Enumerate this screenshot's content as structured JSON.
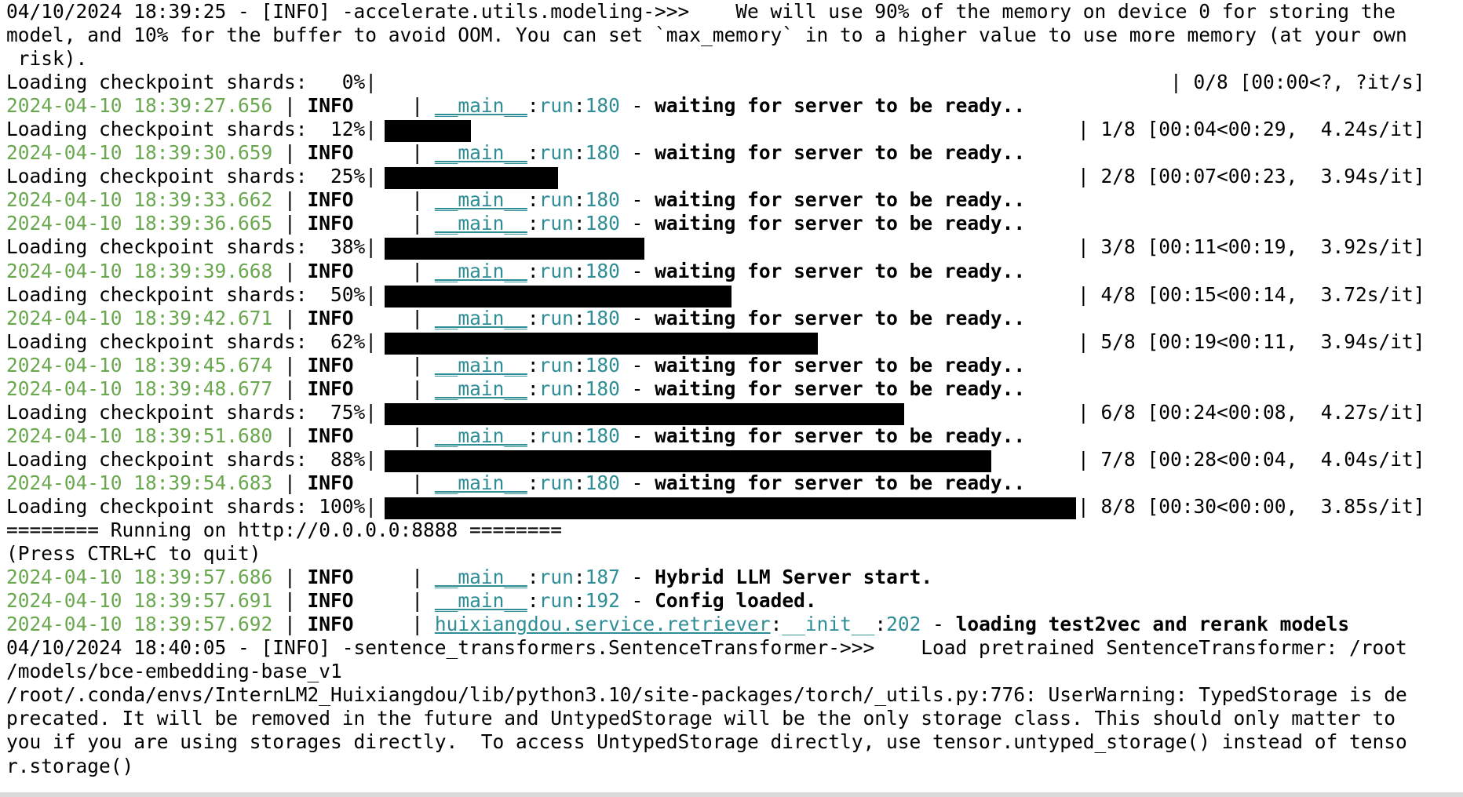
{
  "colors": {
    "background": "#ffffff",
    "text": "#000000",
    "timestamp": "#6aa84f",
    "module": "#2f8d96",
    "progress_fill": "#000000"
  },
  "lines": [
    {
      "kind": "plain",
      "text": "04/10/2024 18:39:25 - [INFO] -accelerate.utils.modeling->>>    We will use 90% of the memory on device 0 for storing the"
    },
    {
      "kind": "plain",
      "text": "model, and 10% for the buffer to avoid OOM. You can set `max_memory` in to a higher value to use more memory (at your own"
    },
    {
      "kind": "plain",
      "text": " risk)."
    },
    {
      "kind": "progress",
      "prefix": "Loading checkpoint shards:   0%|",
      "fraction": 0.0,
      "stats": "| 0/8 [00:00<?, ?it/s]",
      "stats_offset_chars": 8
    },
    {
      "kind": "log",
      "ts": "2024-04-10 18:39:27.656",
      "sep1": " | ",
      "lvl": "INFO",
      "sep2": "     | ",
      "mod": "__main__",
      "colon1": ":",
      "fn": "run",
      "colon2": ":",
      "lnum": "180",
      "dash": " - ",
      "msg": "waiting for server to be ready.."
    },
    {
      "kind": "progress",
      "prefix": "Loading checkpoint shards:  12%|",
      "fraction": 0.125,
      "stats": "| 1/8 [00:04<00:29,  4.24s/it]"
    },
    {
      "kind": "log",
      "ts": "2024-04-10 18:39:30.659",
      "sep1": " | ",
      "lvl": "INFO",
      "sep2": "     | ",
      "mod": "__main__",
      "colon1": ":",
      "fn": "run",
      "colon2": ":",
      "lnum": "180",
      "dash": " - ",
      "msg": "waiting for server to be ready.."
    },
    {
      "kind": "progress",
      "prefix": "Loading checkpoint shards:  25%|",
      "fraction": 0.25,
      "stats": "| 2/8 [00:07<00:23,  3.94s/it]"
    },
    {
      "kind": "log",
      "ts": "2024-04-10 18:39:33.662",
      "sep1": " | ",
      "lvl": "INFO",
      "sep2": "     | ",
      "mod": "__main__",
      "colon1": ":",
      "fn": "run",
      "colon2": ":",
      "lnum": "180",
      "dash": " - ",
      "msg": "waiting for server to be ready.."
    },
    {
      "kind": "log",
      "ts": "2024-04-10 18:39:36.665",
      "sep1": " | ",
      "lvl": "INFO",
      "sep2": "     | ",
      "mod": "__main__",
      "colon1": ":",
      "fn": "run",
      "colon2": ":",
      "lnum": "180",
      "dash": " - ",
      "msg": "waiting for server to be ready.."
    },
    {
      "kind": "progress",
      "prefix": "Loading checkpoint shards:  38%|",
      "fraction": 0.375,
      "stats": "| 3/8 [00:11<00:19,  3.92s/it]"
    },
    {
      "kind": "log",
      "ts": "2024-04-10 18:39:39.668",
      "sep1": " | ",
      "lvl": "INFO",
      "sep2": "     | ",
      "mod": "__main__",
      "colon1": ":",
      "fn": "run",
      "colon2": ":",
      "lnum": "180",
      "dash": " - ",
      "msg": "waiting for server to be ready.."
    },
    {
      "kind": "progress",
      "prefix": "Loading checkpoint shards:  50%|",
      "fraction": 0.5,
      "stats": "| 4/8 [00:15<00:14,  3.72s/it]"
    },
    {
      "kind": "log",
      "ts": "2024-04-10 18:39:42.671",
      "sep1": " | ",
      "lvl": "INFO",
      "sep2": "     | ",
      "mod": "__main__",
      "colon1": ":",
      "fn": "run",
      "colon2": ":",
      "lnum": "180",
      "dash": " - ",
      "msg": "waiting for server to be ready.."
    },
    {
      "kind": "progress",
      "prefix": "Loading checkpoint shards:  62%|",
      "fraction": 0.625,
      "stats": "| 5/8 [00:19<00:11,  3.94s/it]"
    },
    {
      "kind": "log",
      "ts": "2024-04-10 18:39:45.674",
      "sep1": " | ",
      "lvl": "INFO",
      "sep2": "     | ",
      "mod": "__main__",
      "colon1": ":",
      "fn": "run",
      "colon2": ":",
      "lnum": "180",
      "dash": " - ",
      "msg": "waiting for server to be ready.."
    },
    {
      "kind": "log",
      "ts": "2024-04-10 18:39:48.677",
      "sep1": " | ",
      "lvl": "INFO",
      "sep2": "     | ",
      "mod": "__main__",
      "colon1": ":",
      "fn": "run",
      "colon2": ":",
      "lnum": "180",
      "dash": " - ",
      "msg": "waiting for server to be ready.."
    },
    {
      "kind": "progress",
      "prefix": "Loading checkpoint shards:  75%|",
      "fraction": 0.75,
      "stats": "| 6/8 [00:24<00:08,  4.27s/it]"
    },
    {
      "kind": "log",
      "ts": "2024-04-10 18:39:51.680",
      "sep1": " | ",
      "lvl": "INFO",
      "sep2": "     | ",
      "mod": "__main__",
      "colon1": ":",
      "fn": "run",
      "colon2": ":",
      "lnum": "180",
      "dash": " - ",
      "msg": "waiting for server to be ready.."
    },
    {
      "kind": "progress",
      "prefix": "Loading checkpoint shards:  88%|",
      "fraction": 0.875,
      "stats": "| 7/8 [00:28<00:04,  4.04s/it]"
    },
    {
      "kind": "log",
      "ts": "2024-04-10 18:39:54.683",
      "sep1": " | ",
      "lvl": "INFO",
      "sep2": "     | ",
      "mod": "__main__",
      "colon1": ":",
      "fn": "run",
      "colon2": ":",
      "lnum": "180",
      "dash": " - ",
      "msg": "waiting for server to be ready.."
    },
    {
      "kind": "progress",
      "prefix": "Loading checkpoint shards: 100%|",
      "fraction": 1.0,
      "stats": "| 8/8 [00:30<00:00,  3.85s/it]"
    },
    {
      "kind": "plain",
      "text": "======== Running on http://0.0.0.0:8888 ========"
    },
    {
      "kind": "plain",
      "text": "(Press CTRL+C to quit)"
    },
    {
      "kind": "log",
      "ts": "2024-04-10 18:39:57.686",
      "sep1": " | ",
      "lvl": "INFO",
      "sep2": "     | ",
      "mod": "__main__",
      "colon1": ":",
      "fn": "run",
      "colon2": ":",
      "lnum": "187",
      "dash": " - ",
      "msg": "Hybrid LLM Server start."
    },
    {
      "kind": "log",
      "ts": "2024-04-10 18:39:57.691",
      "sep1": " | ",
      "lvl": "INFO",
      "sep2": "     | ",
      "mod": "__main__",
      "colon1": ":",
      "fn": "run",
      "colon2": ":",
      "lnum": "192",
      "dash": " - ",
      "msg": "Config loaded."
    },
    {
      "kind": "log",
      "ts": "2024-04-10 18:39:57.692",
      "sep1": " | ",
      "lvl": "INFO",
      "sep2": "     | ",
      "mod": "huixiangdou.service.retriever",
      "colon1": ":",
      "fn": "__init__",
      "colon2": ":",
      "lnum": "202",
      "dash": " - ",
      "msg": "loading test2vec and rerank models"
    },
    {
      "kind": "plain",
      "text": "04/10/2024 18:40:05 - [INFO] -sentence_transformers.SentenceTransformer->>>    Load pretrained SentenceTransformer: /root"
    },
    {
      "kind": "plain",
      "text": "/models/bce-embedding-base_v1"
    },
    {
      "kind": "plain",
      "text": "/root/.conda/envs/InternLM2_Huixiangdou/lib/python3.10/site-packages/torch/_utils.py:776: UserWarning: TypedStorage is de"
    },
    {
      "kind": "plain",
      "text": "precated. It will be removed in the future and UntypedStorage will be the only storage class. This should only matter to"
    },
    {
      "kind": "plain",
      "text": "you if you are using storages directly.  To access UntypedStorage directly, use tensor.untyped_storage() instead of tenso"
    },
    {
      "kind": "plain",
      "text": "r.storage()"
    }
  ]
}
